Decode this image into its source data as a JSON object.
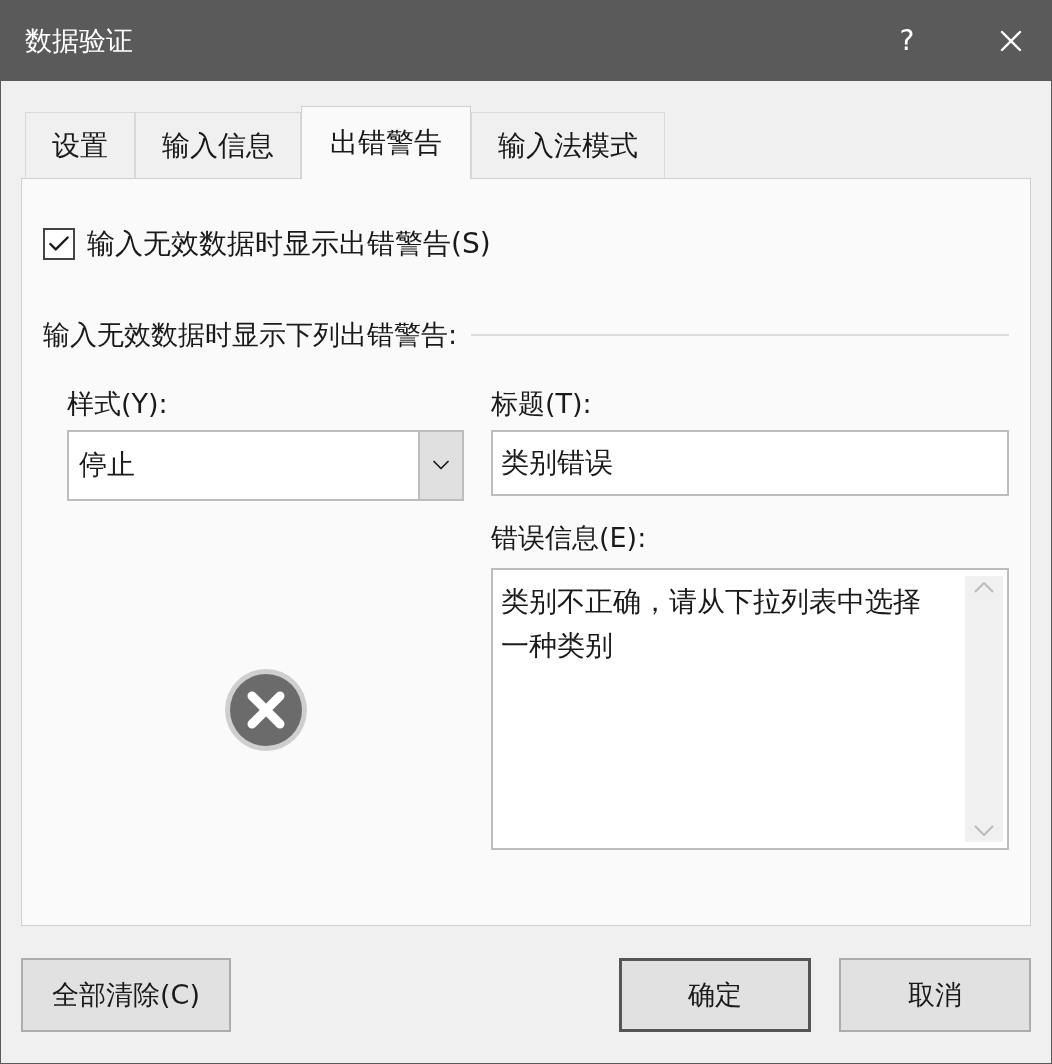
{
  "window": {
    "title": "数据验证",
    "help_glyph": "?"
  },
  "tabs": [
    {
      "label": "设置",
      "selected": false
    },
    {
      "label": "输入信息",
      "selected": false
    },
    {
      "label": "出错警告",
      "selected": true
    },
    {
      "label": "输入法模式",
      "selected": false
    }
  ],
  "show_alert_checkbox": {
    "label": "输入无效数据时显示出错警告(S)",
    "checked": true
  },
  "section_label": "输入无效数据时显示下列出错警告:",
  "style_field": {
    "label": "样式(Y):",
    "value": "停止"
  },
  "alert_icon": {
    "kind": "stop"
  },
  "title_field": {
    "label": "标题(T):",
    "value": "类别错误"
  },
  "message_field": {
    "label": "错误信息(E):",
    "value": "类别不正确，请从下拉列表中选择一种类别"
  },
  "clear_button": {
    "label": "全部清除(C)"
  },
  "buttons": [
    {
      "label": "确定",
      "default": true
    },
    {
      "label": "取消",
      "default": false
    }
  ]
}
